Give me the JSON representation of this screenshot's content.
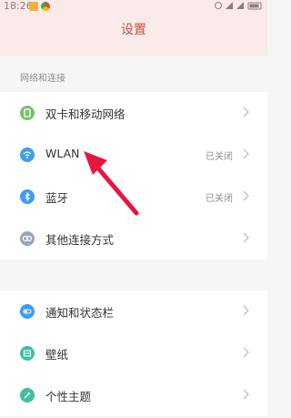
{
  "status_bar": {
    "time": "18:26"
  },
  "header": {
    "title": "设置"
  },
  "section": {
    "label": "网络和连接"
  },
  "group1": [
    {
      "label": "双卡和移动网络",
      "value": "",
      "icon": "sim-card-icon",
      "color": "#77c26a"
    },
    {
      "label": "WLAN",
      "value": "已关闭",
      "icon": "wifi-icon",
      "color": "#3d9df2"
    },
    {
      "label": "蓝牙",
      "value": "已关闭",
      "icon": "bluetooth-icon",
      "color": "#3d9df2"
    },
    {
      "label": "其他连接方式",
      "value": "",
      "icon": "link-icon",
      "color": "#9aa7b5"
    }
  ],
  "group2": [
    {
      "label": "通知和状态栏",
      "value": "",
      "icon": "toggle-icon",
      "color": "#3d9df2"
    },
    {
      "label": "壁纸",
      "value": "",
      "icon": "wallpaper-icon",
      "color": "#3cc2a2"
    },
    {
      "label": "个性主题",
      "value": "",
      "icon": "theme-brush-icon",
      "color": "#3cc2a2"
    }
  ],
  "colors": {
    "accent": "#c2543f",
    "header_bg": "#fbeaea",
    "arrow": "#e6163f"
  }
}
